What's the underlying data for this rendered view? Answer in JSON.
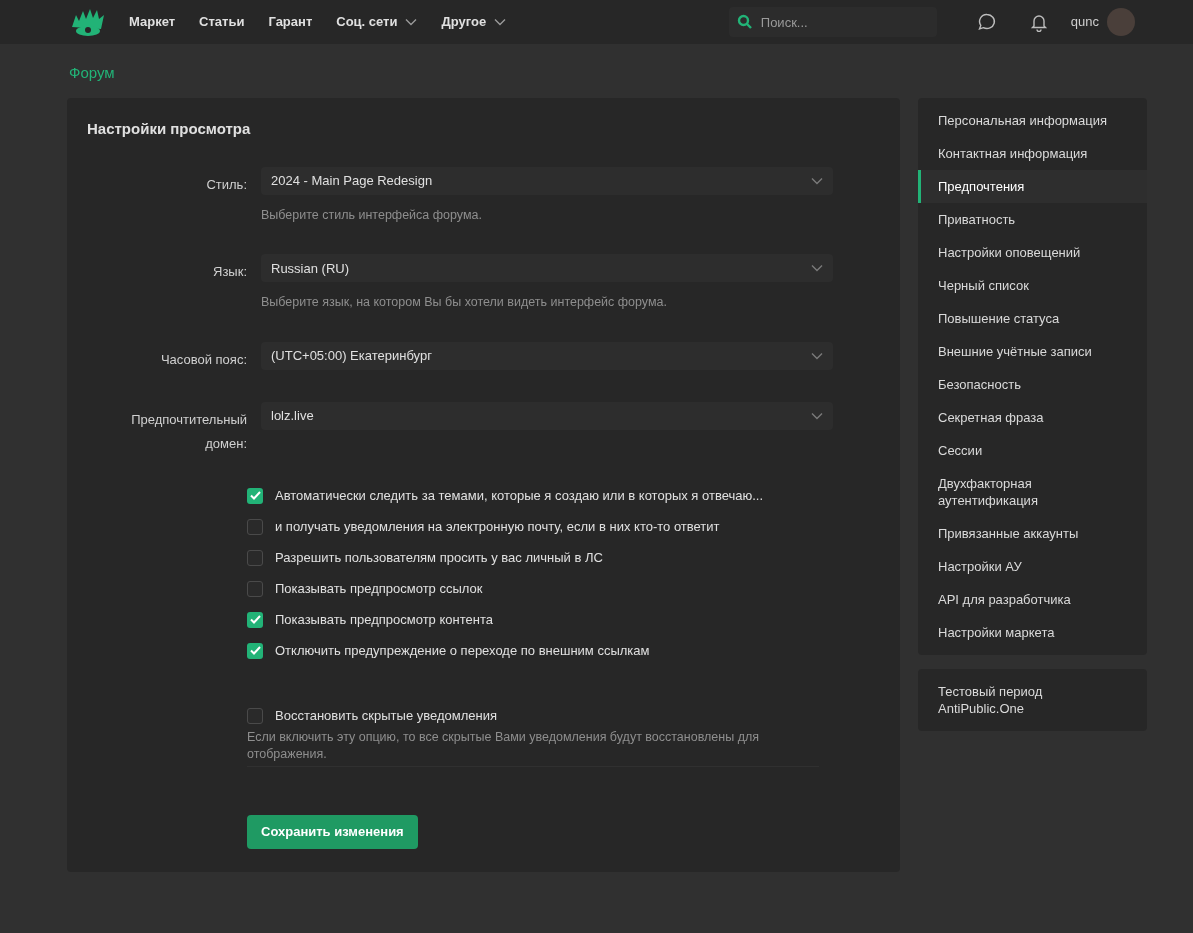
{
  "nav": {
    "items": [
      {
        "label": "Маркет",
        "dropdown": false
      },
      {
        "label": "Статьи",
        "dropdown": false
      },
      {
        "label": "Гарант",
        "dropdown": false
      },
      {
        "label": "Соц. сети",
        "dropdown": true
      },
      {
        "label": "Другое",
        "dropdown": true
      }
    ],
    "search": {
      "placeholder": "Поиск..."
    },
    "username": "qunc"
  },
  "breadcrumb": "Форум",
  "settings": {
    "title": "Настройки просмотра",
    "fields": [
      {
        "label": "Стиль:",
        "value": "2024 - Main Page Redesign",
        "hint": "Выберите стиль интерфейса форума."
      },
      {
        "label": "Язык:",
        "value": "Russian (RU)",
        "hint": "Выберите язык, на котором Вы бы хотели видеть интерфейс форума."
      },
      {
        "label": "Часовой пояс:",
        "value": "(UTC+05:00) Екатеринбург"
      },
      {
        "label": "Предпочтительный домен:",
        "value": "lolz.live"
      }
    ],
    "options": [
      {
        "label": "Автоматически следить за темами, которые я создаю или в которых я отвечаю...",
        "checked": true
      },
      {
        "label": "и получать уведомления на электронную почту, если в них кто-то ответит",
        "checked": false
      },
      {
        "label": "Разрешить пользователям просить у вас личный в ЛС",
        "checked": false
      },
      {
        "label": "Показывать предпросмотр ссылок",
        "checked": false
      },
      {
        "label": "Показывать предпросмотр контента",
        "checked": true
      },
      {
        "label": "Отключить предупреждение о переходе по внешним ссылкам",
        "checked": true
      }
    ],
    "restore": {
      "label": "Восстановить скрытые уведомления",
      "checked": false,
      "hint": "Если включить эту опцию, то все скрытые Вами уведомления будут восстановлены для отображения."
    },
    "save_button": "Сохранить изменения"
  },
  "sidebar": {
    "items": [
      {
        "label": "Персональная информация",
        "selected": false
      },
      {
        "label": "Контактная информация",
        "selected": false
      },
      {
        "label": "Предпочтения",
        "selected": true
      },
      {
        "label": "Приватность",
        "selected": false
      },
      {
        "label": "Настройки оповещений",
        "selected": false
      },
      {
        "label": "Черный список",
        "selected": false
      },
      {
        "label": "Повышение статуса",
        "selected": false
      },
      {
        "label": "Внешние учётные записи",
        "selected": false
      },
      {
        "label": "Безопасность",
        "selected": false
      },
      {
        "label": "Секретная фраза",
        "selected": false
      },
      {
        "label": "Сессии",
        "selected": false
      },
      {
        "label": "Двухфакторная аутентификация",
        "selected": false
      },
      {
        "label": "Привязанные аккаунты",
        "selected": false
      },
      {
        "label": "Настройки АУ",
        "selected": false
      },
      {
        "label": "API для разработчика",
        "selected": false
      },
      {
        "label": "Настройки маркета",
        "selected": false
      }
    ],
    "extra": [
      {
        "label": "Тестовый период AntiPublic.One",
        "selected": false
      }
    ]
  }
}
